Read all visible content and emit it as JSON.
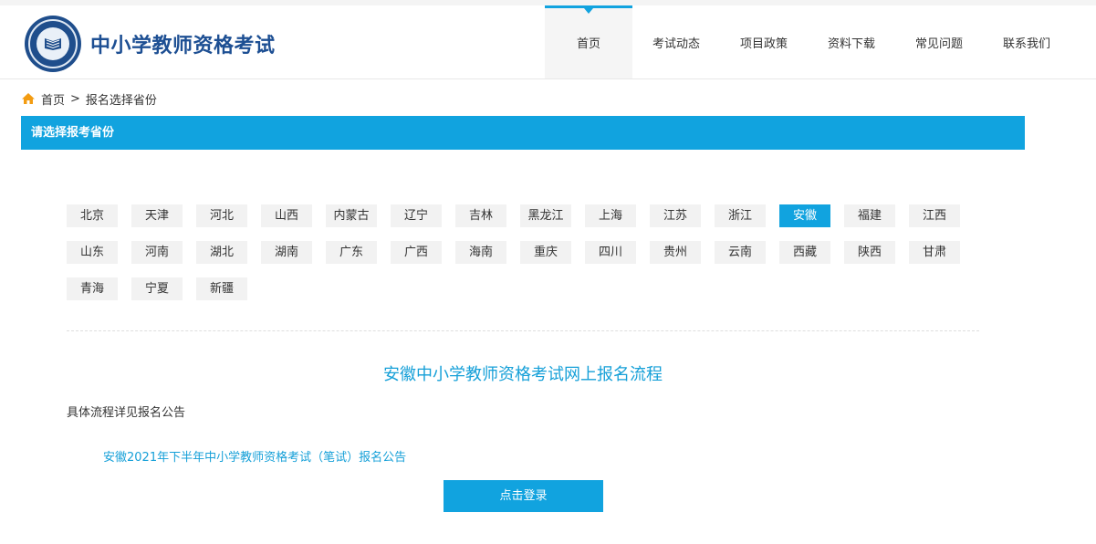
{
  "colors": {
    "accent": "#11a3df",
    "brand_blue": "#1d4f93",
    "link": "#16a0d8"
  },
  "site": {
    "title": "中小学教师资格考试"
  },
  "nav": [
    {
      "label": "首页",
      "active": true
    },
    {
      "label": "考试动态",
      "active": false
    },
    {
      "label": "项目政策",
      "active": false
    },
    {
      "label": "资料下载",
      "active": false
    },
    {
      "label": "常见问题",
      "active": false
    },
    {
      "label": "联系我们",
      "active": false
    }
  ],
  "breadcrumb": {
    "icon": "home-icon",
    "home": "首页",
    "separator": ">",
    "current": "报名选择省份"
  },
  "section": {
    "title": "请选择报考省份"
  },
  "provinces": {
    "selected": "安徽",
    "rows": [
      [
        "北京",
        "天津",
        "河北",
        "山西",
        "内蒙古",
        "辽宁",
        "吉林",
        "黑龙江",
        "上海",
        "江苏",
        "浙江",
        "安徽",
        "福建",
        "江西"
      ],
      [
        "山东",
        "河南",
        "湖北",
        "湖南",
        "广东",
        "广西",
        "海南",
        "重庆",
        "四川",
        "贵州",
        "云南",
        "西藏",
        "陕西",
        "甘肃"
      ],
      [
        "青海",
        "宁夏",
        "新疆"
      ]
    ]
  },
  "flow": {
    "title": "安徽中小学教师资格考试网上报名流程",
    "desc": "具体流程详见报名公告",
    "notice_link": "安徽2021年下半年中小学教师资格考试（笔试）报名公告",
    "login_button": "点击登录"
  }
}
